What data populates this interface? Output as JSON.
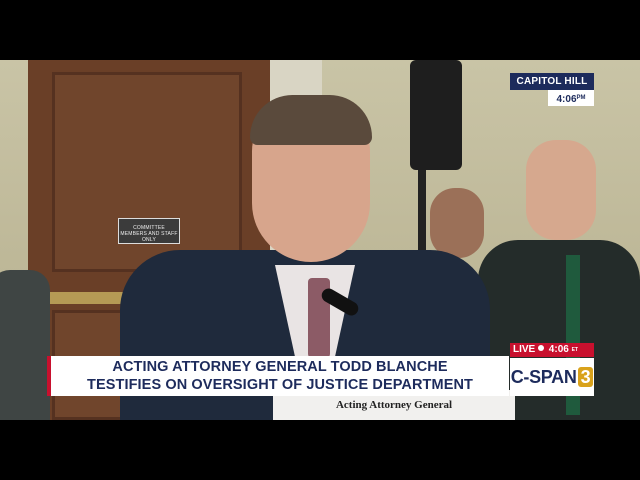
{
  "overlay": {
    "location": "CAPITOL HILL",
    "location_time": "4:06",
    "location_time_suffix": "PM",
    "headline_line1": "ACTING ATTORNEY GENERAL TODD BLANCHE",
    "headline_line2": "TESTIFIES ON OVERSIGHT OF JUSTICE DEPARTMENT",
    "live_label": "LIVE",
    "live_time": "4:06",
    "live_tz": "ET",
    "brand": "C-SPAN",
    "brand_number": "3"
  },
  "scene": {
    "nameplate": "Acting Attorney General",
    "door_sign": "COMMITTEE MEMBERS AND STAFF ONLY"
  },
  "colors": {
    "navy": "#1d2b5c",
    "red": "#c8102e",
    "gold": "#d9a21b"
  }
}
